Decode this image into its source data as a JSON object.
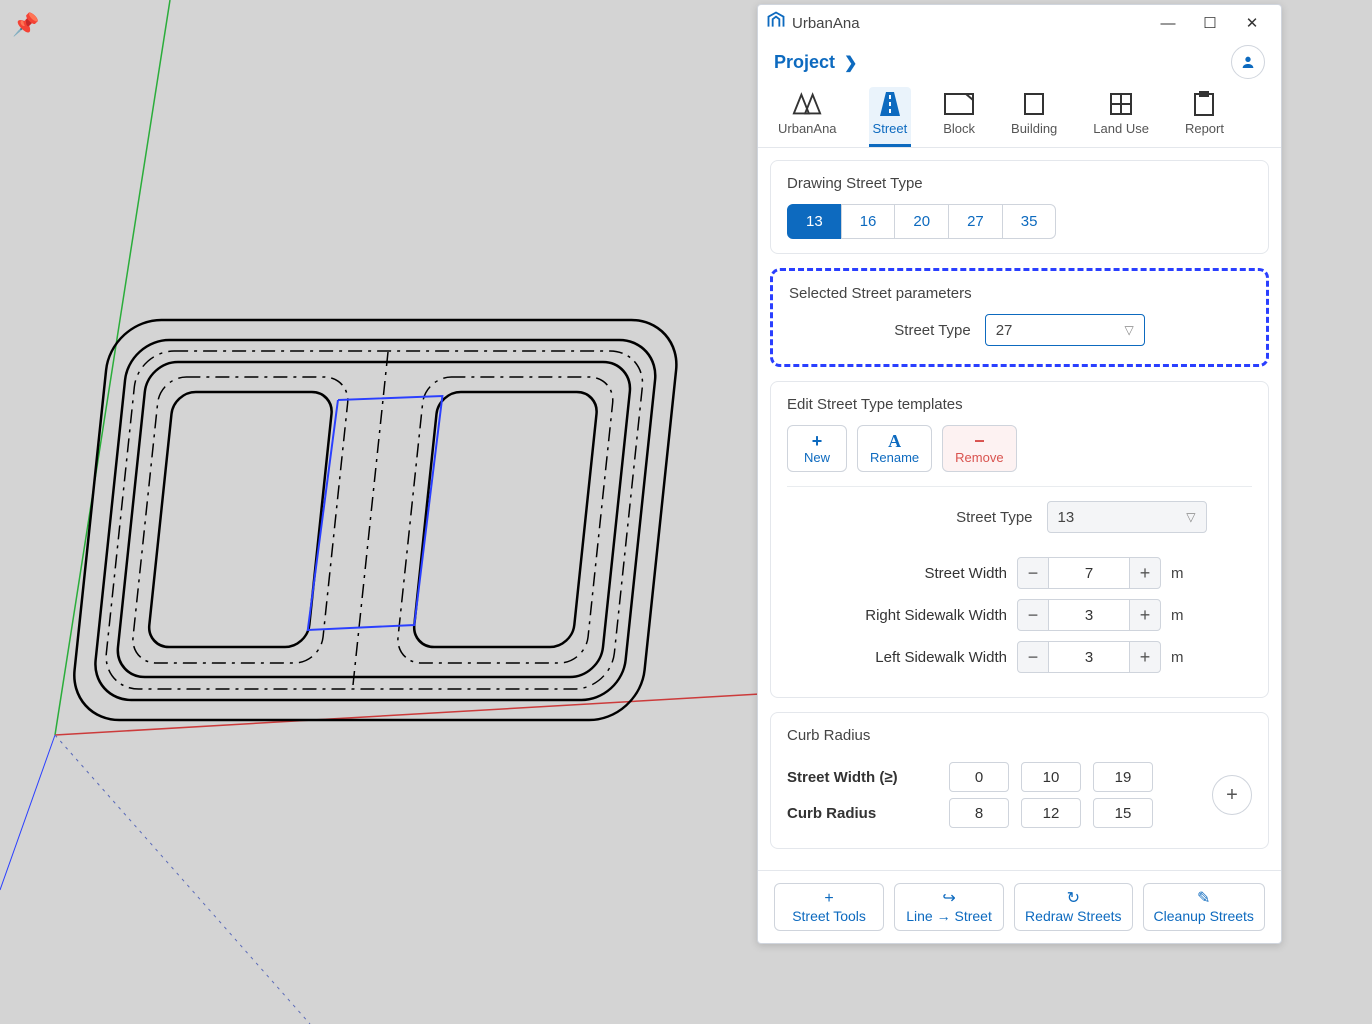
{
  "app": {
    "title": "UrbanAna"
  },
  "breadcrumb": {
    "label": "Project"
  },
  "tabs": [
    {
      "label": "UrbanAna"
    },
    {
      "label": "Street"
    },
    {
      "label": "Block"
    },
    {
      "label": "Building"
    },
    {
      "label": "Land Use"
    },
    {
      "label": "Report"
    }
  ],
  "drawing": {
    "title": "Drawing Street Type",
    "options": [
      "13",
      "16",
      "20",
      "27",
      "35"
    ],
    "active": "13"
  },
  "selected": {
    "title": "Selected Street parameters",
    "label": "Street Type",
    "value": "27"
  },
  "edit": {
    "title": "Edit Street Type templates",
    "new": "New",
    "rename": "Rename",
    "remove": "Remove",
    "type_label": "Street Type",
    "type_value": "13",
    "rows": [
      {
        "label": "Street Width",
        "value": "7",
        "unit": "m"
      },
      {
        "label": "Right Sidewalk Width",
        "value": "3",
        "unit": "m"
      },
      {
        "label": "Left Sidewalk Width",
        "value": "3",
        "unit": "m"
      }
    ]
  },
  "curb": {
    "title": "Curb Radius",
    "width_label": "Street Width (≥)",
    "radius_label": "Curb Radius",
    "widths": [
      "0",
      "10",
      "19"
    ],
    "radii": [
      "8",
      "12",
      "15"
    ]
  },
  "footer": {
    "tools": "Street Tools",
    "line": "Line → Street",
    "redraw": "Redraw Streets",
    "cleanup": "Cleanup Streets"
  }
}
